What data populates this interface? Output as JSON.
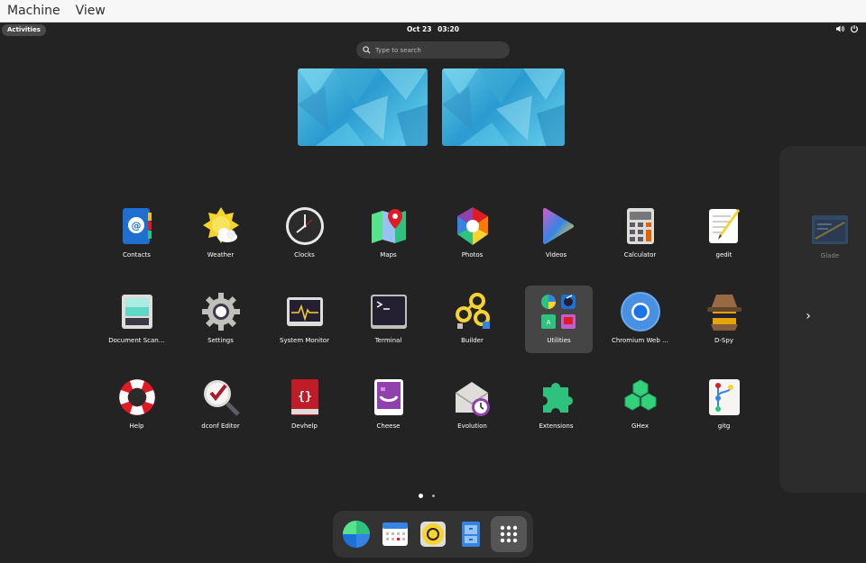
{
  "menubar": {
    "items": [
      "Machine",
      "View"
    ]
  },
  "topbar": {
    "activities": "Activities",
    "date": "Oct 23",
    "time": "03:20",
    "icons": [
      "volume-icon",
      "power-icon"
    ]
  },
  "search": {
    "placeholder": "Type to search"
  },
  "workspaces": [
    "workspace-1",
    "workspace-2"
  ],
  "apps": [
    {
      "label": "Contacts",
      "icon": "contacts-icon"
    },
    {
      "label": "Weather",
      "icon": "weather-icon"
    },
    {
      "label": "Clocks",
      "icon": "clocks-icon"
    },
    {
      "label": "Maps",
      "icon": "maps-icon"
    },
    {
      "label": "Photos",
      "icon": "photos-icon"
    },
    {
      "label": "Videos",
      "icon": "videos-icon"
    },
    {
      "label": "Calculator",
      "icon": "calculator-icon"
    },
    {
      "label": "gedit",
      "icon": "gedit-icon"
    },
    {
      "label": "Document Scan…",
      "icon": "document-scanner-icon"
    },
    {
      "label": "Settings",
      "icon": "settings-icon"
    },
    {
      "label": "System Monitor",
      "icon": "system-monitor-icon"
    },
    {
      "label": "Terminal",
      "icon": "terminal-icon"
    },
    {
      "label": "Builder",
      "icon": "builder-icon"
    },
    {
      "label": "Utilities",
      "icon": "utilities-folder-icon",
      "selected": true
    },
    {
      "label": "Chromium Web …",
      "icon": "chromium-icon"
    },
    {
      "label": "D-Spy",
      "icon": "d-spy-icon"
    },
    {
      "label": "Help",
      "icon": "help-icon"
    },
    {
      "label": "dconf Editor",
      "icon": "dconf-editor-icon"
    },
    {
      "label": "Devhelp",
      "icon": "devhelp-icon"
    },
    {
      "label": "Cheese",
      "icon": "cheese-icon"
    },
    {
      "label": "Evolution",
      "icon": "evolution-icon"
    },
    {
      "label": "Extensions",
      "icon": "extensions-icon"
    },
    {
      "label": "GHex",
      "icon": "ghex-icon"
    },
    {
      "label": "gitg",
      "icon": "gitg-icon"
    }
  ],
  "next_page": {
    "label": "Glade",
    "icon": "glade-icon",
    "arrow": "›"
  },
  "pager": {
    "pages": 2,
    "current": 1
  },
  "dock": [
    {
      "name": "web-browser-icon"
    },
    {
      "name": "calendar-icon"
    },
    {
      "name": "rhythmbox-icon"
    },
    {
      "name": "files-icon"
    },
    {
      "name": "show-apps-icon",
      "active": true
    }
  ],
  "colors": {
    "background": "#232323",
    "accent": "#3584e4"
  }
}
